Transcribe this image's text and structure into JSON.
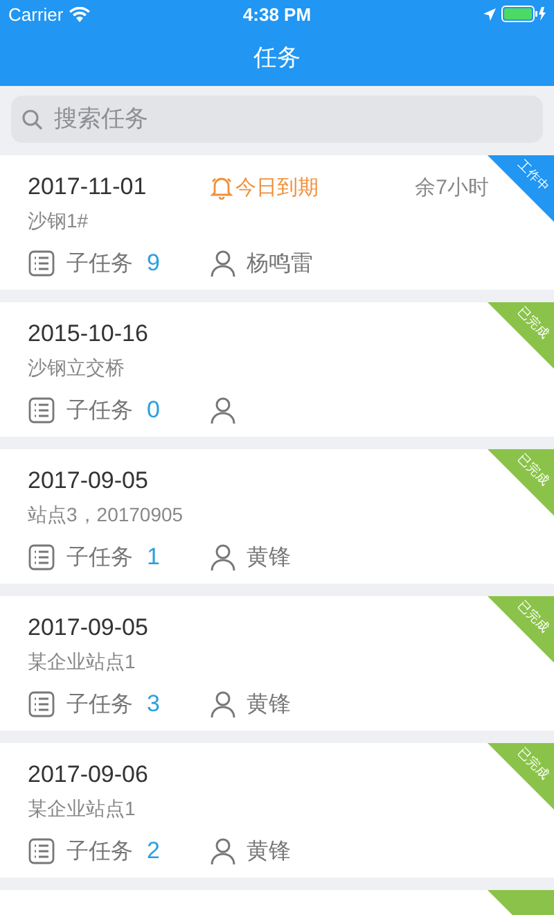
{
  "status_bar": {
    "carrier": "Carrier",
    "time": "4:38 PM"
  },
  "header": {
    "title": "任务"
  },
  "search": {
    "placeholder": "搜索任务"
  },
  "tasks": [
    {
      "date": "2017-11-01",
      "alert": "今日到期",
      "remaining": "余7小时",
      "name": "沙钢1#",
      "subtask_label": "子任务",
      "subtask_count": "9",
      "assignee": "杨鸣雷",
      "color": "#2196f3",
      "status_label": "工作中"
    },
    {
      "date": "2015-10-16",
      "name": "沙钢立交桥",
      "subtask_label": "子任务",
      "subtask_count": "0",
      "color": "#8bc34a",
      "status_label": "已完成"
    },
    {
      "date": "2017-09-05",
      "name": "站点3，20170905",
      "subtask_label": "子任务",
      "subtask_count": "1",
      "assignee": "黄锋",
      "color": "#8bc34a",
      "status_label": "已完成"
    },
    {
      "date": "2017-09-05",
      "name": "某企业站点1",
      "subtask_label": "子任务",
      "subtask_count": "3",
      "assignee": "黄锋",
      "color": "#8bc34a",
      "status_label": "已完成"
    },
    {
      "date": "2017-09-06",
      "name": "某企业站点1",
      "subtask_label": "子任务",
      "subtask_count": "2",
      "assignee": "黄锋",
      "color": "#8bc34a",
      "status_label": "已完成"
    },
    {
      "color": "#8bc34a"
    }
  ]
}
